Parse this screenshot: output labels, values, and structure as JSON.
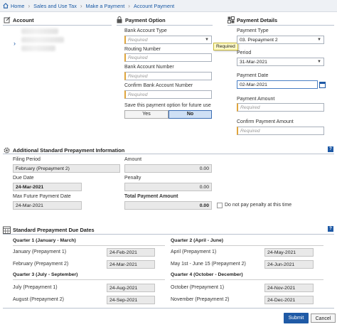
{
  "breadcrumb": {
    "items": [
      "Home",
      "Sales and Use Tax",
      "Make a Payment",
      "Account Payment"
    ]
  },
  "account": {
    "title": "Account"
  },
  "payment_option": {
    "title": "Payment Option",
    "bank_account_type_label": "Bank Account Type",
    "bank_account_type_placeholder": "Required",
    "routing_label": "Routing Number",
    "routing_placeholder": "Required",
    "bank_account_label": "Bank Account Number",
    "bank_account_placeholder": "Required",
    "confirm_label": "Confirm Bank Account Number",
    "confirm_placeholder": "Required",
    "save_label": "Save this payment option for future use",
    "yes": "Yes",
    "no": "No",
    "tooltip": "Required"
  },
  "payment_details": {
    "title": "Payment Details",
    "type_label": "Payment Type",
    "type_value": "03. Prepayment 2",
    "period_label": "Period",
    "period_value": "31-Mar-2021",
    "date_label": "Payment Date",
    "date_value": "02-Mar-2021",
    "amount_label": "Payment Amount",
    "amount_placeholder": "Required",
    "confirm_amount_label": "Confirm Payment Amount",
    "confirm_amount_placeholder": "Required"
  },
  "prepayment_info": {
    "title": "Additional Standard Prepayment Information",
    "help": "?",
    "filing_period_label": "Filing Period",
    "filing_period_value": "February (Prepayment 2)",
    "amount_label": "Amount",
    "amount_value": "0.00",
    "due_date_label": "Due Date",
    "due_date_value": "24-Mar-2021",
    "penalty_label": "Penalty",
    "penalty_value": "0.00",
    "max_future_label": "Max Future Payment Date",
    "max_future_value": "24-Mar-2021",
    "total_label": "Total Payment Amount",
    "total_value": "0.00",
    "no_penalty_label": "Do not pay penalty at this time"
  },
  "due_dates": {
    "title": "Standard Prepayment Due Dates",
    "help": "?",
    "quarters": [
      {
        "title": "Quarter 1 (January - March)",
        "rows": [
          {
            "label": "January (Prepayment 1)",
            "date": "24-Feb-2021"
          },
          {
            "label": "February (Prepayment 2)",
            "date": "24-Mar-2021"
          }
        ]
      },
      {
        "title": "Quarter 2 (April - June)",
        "rows": [
          {
            "label": "April (Prepayment 1)",
            "date": "24-May-2021"
          },
          {
            "label": "May 1st - June 15 (Prepayment 2)",
            "date": "24-Jun-2021"
          }
        ]
      },
      {
        "title": "Quarter 3 (July - September)",
        "rows": [
          {
            "label": "July (Prepayment 1)",
            "date": "24-Aug-2021"
          },
          {
            "label": "August (Prepayment 2)",
            "date": "24-Sep-2021"
          }
        ]
      },
      {
        "title": "Quarter 4 (October - December)",
        "rows": [
          {
            "label": "October (Prepayment 1)",
            "date": "24-Nov-2021"
          },
          {
            "label": "November (Prepayment 2)",
            "date": "24-Dec-2021"
          }
        ]
      }
    ]
  },
  "actions": {
    "submit": "Submit",
    "cancel": "Cancel"
  },
  "colors": {
    "accent": "#1f5aa6",
    "required_marker": "#e0a53c",
    "tooltip_bg": "#fffbc7"
  }
}
